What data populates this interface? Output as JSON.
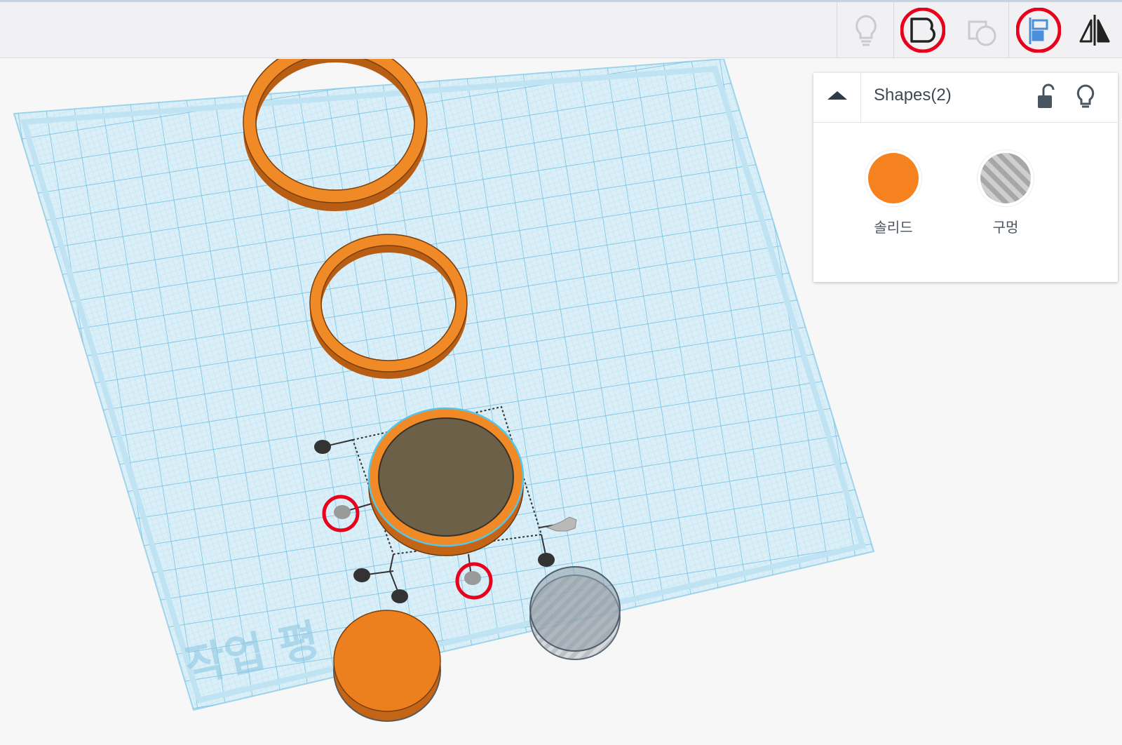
{
  "toolbar": {
    "buttons": [
      {
        "icon": "lightbulb-icon",
        "state": "disabled",
        "highlighted": false
      },
      {
        "icon": "group-icon",
        "state": "enabled",
        "highlighted": true
      },
      {
        "icon": "ungroup-icon",
        "state": "disabled",
        "highlighted": false
      },
      {
        "icon": "align-icon",
        "state": "active",
        "highlighted": true
      },
      {
        "icon": "mirror-icon",
        "state": "enabled",
        "highlighted": false
      }
    ],
    "highlight_color": "#e8001c"
  },
  "workplane": {
    "watermark": "작업 평",
    "grid_color": "#a6d8ee",
    "shapes": [
      {
        "kind": "ring",
        "color": "#e8801e"
      },
      {
        "kind": "ring",
        "color": "#e8801e"
      },
      {
        "kind": "cylinder",
        "color": "#e8801e",
        "selected": true
      },
      {
        "kind": "cylinder",
        "color": "#e8801e"
      },
      {
        "kind": "hole-cylinder",
        "color": "#9aa3ad"
      }
    ]
  },
  "shapes_panel": {
    "title": "Shapes(2)",
    "collapse_icon": "triangle-up-icon",
    "lock_icon": "unlock-icon",
    "bulb_icon": "lightbulb-icon",
    "options": [
      {
        "label": "솔리드",
        "color": "#f5821f",
        "kind": "solid"
      },
      {
        "label": "구멍",
        "color": "#a9a9a9",
        "kind": "hole"
      }
    ]
  }
}
